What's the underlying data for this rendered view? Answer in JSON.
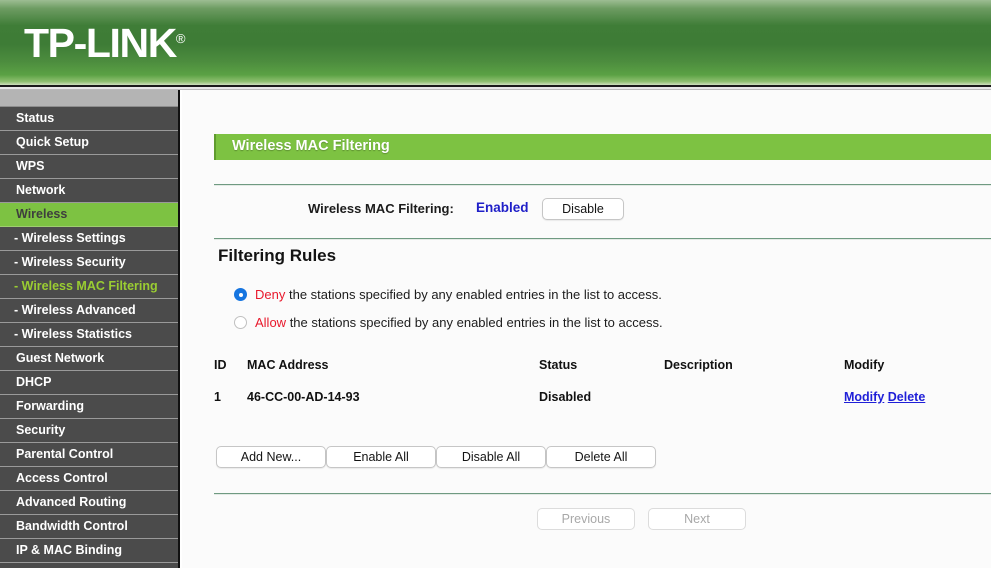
{
  "brand": {
    "name": "TP-LINK",
    "registered": "®"
  },
  "sidebar": {
    "items": [
      {
        "label": "Status",
        "level": "top",
        "state": "normal"
      },
      {
        "label": "Quick Setup",
        "level": "top",
        "state": "normal"
      },
      {
        "label": "WPS",
        "level": "top",
        "state": "normal"
      },
      {
        "label": "Network",
        "level": "top",
        "state": "normal"
      },
      {
        "label": "Wireless",
        "level": "top",
        "state": "active-parent"
      },
      {
        "label": "- Wireless Settings",
        "level": "sub",
        "state": "normal"
      },
      {
        "label": "- Wireless Security",
        "level": "sub",
        "state": "normal"
      },
      {
        "label": "- Wireless MAC Filtering",
        "level": "sub",
        "state": "active-sub"
      },
      {
        "label": "- Wireless Advanced",
        "level": "sub",
        "state": "normal"
      },
      {
        "label": "- Wireless Statistics",
        "level": "sub",
        "state": "normal"
      },
      {
        "label": "Guest Network",
        "level": "top",
        "state": "normal"
      },
      {
        "label": "DHCP",
        "level": "top",
        "state": "normal"
      },
      {
        "label": "Forwarding",
        "level": "top",
        "state": "normal"
      },
      {
        "label": "Security",
        "level": "top",
        "state": "normal"
      },
      {
        "label": "Parental Control",
        "level": "top",
        "state": "normal"
      },
      {
        "label": "Access Control",
        "level": "top",
        "state": "normal"
      },
      {
        "label": "Advanced Routing",
        "level": "top",
        "state": "normal"
      },
      {
        "label": "Bandwidth Control",
        "level": "top",
        "state": "normal"
      },
      {
        "label": "IP & MAC Binding",
        "level": "top",
        "state": "normal"
      }
    ]
  },
  "page": {
    "title": "Wireless MAC Filtering",
    "enable": {
      "label": "Wireless MAC Filtering:",
      "state": "Enabled",
      "toggle_button": "Disable"
    },
    "rules": {
      "heading": "Filtering Rules",
      "options": [
        {
          "keyword": "Deny",
          "text": " the stations specified by any enabled entries in the list to access.",
          "selected": true
        },
        {
          "keyword": "Allow",
          "text": " the stations specified by any enabled entries in the list to access.",
          "selected": false
        }
      ]
    },
    "table": {
      "headers": [
        "ID",
        "MAC Address",
        "Status",
        "Description",
        "Modify"
      ],
      "rows": [
        {
          "id": "1",
          "mac": "46-CC-00-AD-14-93",
          "status": "Disabled",
          "description": "",
          "modify": "Modify",
          "delete": "Delete"
        }
      ]
    },
    "actions": {
      "add_new": "Add New...",
      "enable_all": "Enable All",
      "disable_all": "Disable All",
      "delete_all": "Delete All"
    },
    "pager": {
      "previous": "Previous",
      "next": "Next"
    }
  },
  "colors": {
    "brand_green": "#7dc242",
    "header_green_dark": "#3e7c36",
    "link_blue": "#1f1fd8",
    "state_blue": "#1f1fc8",
    "keyword_red": "#e8192c",
    "sidebar_gray": "#4b4b4b",
    "radio_blue": "#1675e0"
  }
}
